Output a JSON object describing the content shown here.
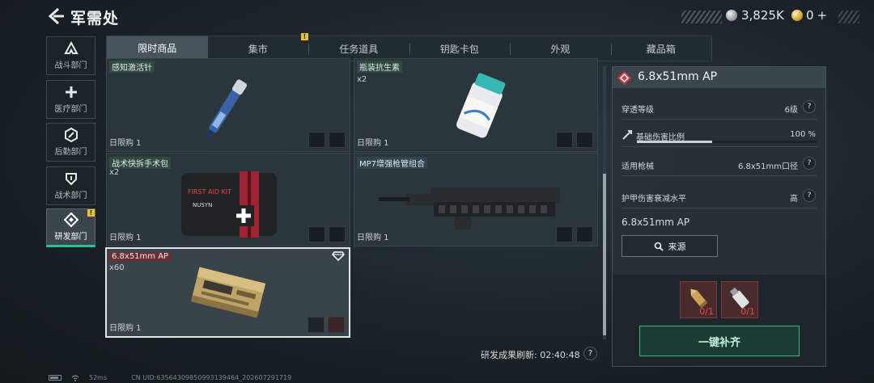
{
  "header": {
    "title": "军需处",
    "currency_1": "3,825K",
    "currency_2": "0",
    "currency_2_add": "+"
  },
  "sidebar": {
    "items": [
      {
        "label": "战斗部门",
        "icon": "a-shape-icon",
        "active": false,
        "badge": ""
      },
      {
        "label": "医疗部门",
        "icon": "plus-icon",
        "active": false,
        "badge": ""
      },
      {
        "label": "后勤部门",
        "icon": "logistics-icon",
        "active": false,
        "badge": ""
      },
      {
        "label": "战术部门",
        "icon": "shield-icon",
        "active": false,
        "badge": ""
      },
      {
        "label": "研发部门",
        "icon": "research-icon",
        "active": true,
        "badge": "!"
      }
    ]
  },
  "tabs": [
    {
      "label": "限时商品",
      "active": true
    },
    {
      "label": "集市",
      "badge": "!"
    },
    {
      "label": "任务道具"
    },
    {
      "label": "钥匙卡包"
    },
    {
      "label": "外观"
    },
    {
      "label": "藏品箱"
    }
  ],
  "items": [
    {
      "name": "感知激活针",
      "qty": "",
      "limit": "日限购 1",
      "name_color": "green"
    },
    {
      "name": "瓶装抗生素",
      "qty": "x2",
      "limit": "日限购 1",
      "name_color": "green"
    },
    {
      "name": "战术快拆手术包",
      "qty": "x2",
      "limit": "日限购 1",
      "name_color": "green"
    },
    {
      "name": "MP7增强枪管组合",
      "qty": "",
      "limit": "日限购 1",
      "name_color": "blue"
    },
    {
      "name": "6.8x51mm AP",
      "qty": "x60",
      "limit": "日限购 1",
      "name_color": "red",
      "selected": true
    }
  ],
  "medkit_text": {
    "brand": "FIRST AID KIT",
    "maker": "NUSYN"
  },
  "refresh": {
    "text": "研发成果刷新: 02:40:48",
    "help": "?"
  },
  "detail": {
    "title": "6.8x51mm AP",
    "rows": [
      {
        "key": "穿透等级",
        "value": "6级",
        "help": "?"
      },
      {
        "key": "基础伤害比例",
        "value": "100 %",
        "help": ""
      },
      {
        "key": "适用枪械",
        "value": "6.8x51mm口径",
        "help": "?"
      },
      {
        "key": "护甲伤害衰减水平",
        "value": "高",
        "help": "?"
      }
    ],
    "damage_ratio_fill": 0.42,
    "description": "6.8x51mm AP",
    "source_button": "来源",
    "requirements": [
      {
        "count": "0/1",
        "icon": "ammo-round-icon"
      },
      {
        "count": "0/1",
        "icon": "usb-device-icon"
      }
    ],
    "fill_button": "一键补齐"
  },
  "status_bar": {
    "ping": "52ms",
    "uid": "CN UID:635643098509931394​64_202607291719"
  },
  "colors": {
    "accent": "#2ec28e",
    "warning": "#e9c22c",
    "rarity_red": "#6e2f32",
    "danger_text": "#e04a4a"
  }
}
